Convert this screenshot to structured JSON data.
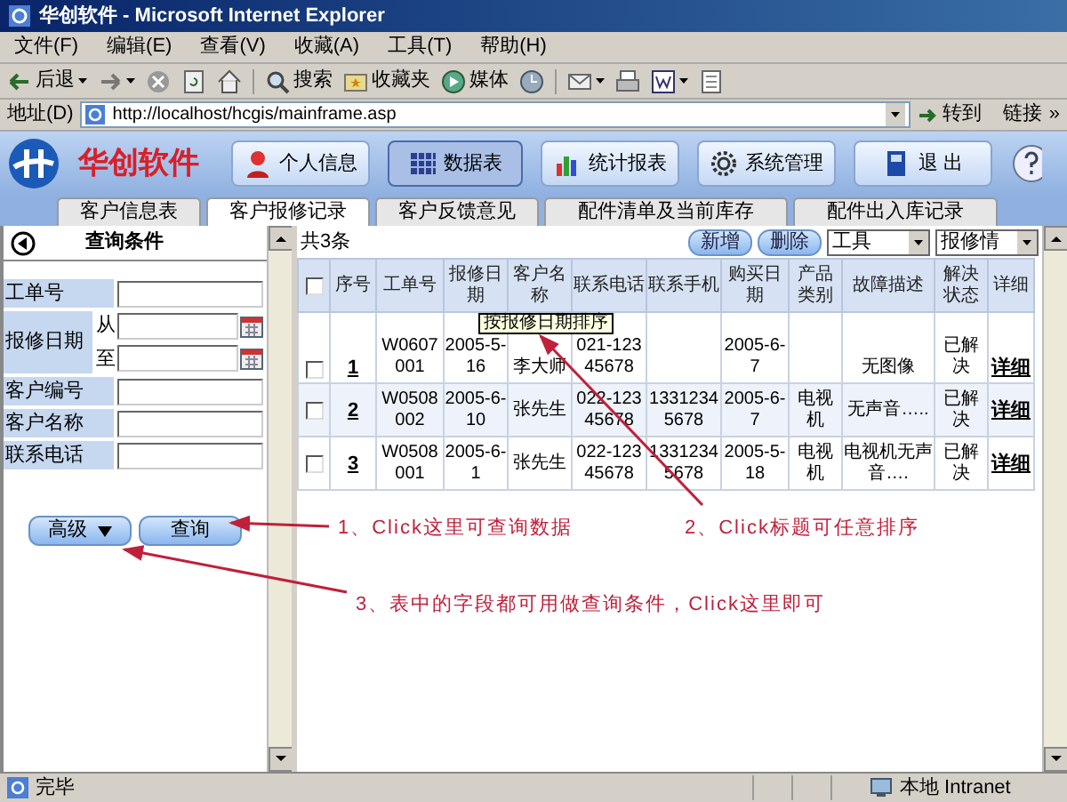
{
  "window": {
    "title": "华创软件 - Microsoft Internet Explorer"
  },
  "menu": [
    "文件(F)",
    "编辑(E)",
    "查看(V)",
    "收藏(A)",
    "工具(T)",
    "帮助(H)"
  ],
  "toolbar": [
    {
      "label": "后退",
      "dropdown": true
    },
    {
      "dropdown": true
    },
    {
      "dropdown": false
    },
    {
      "dropdown": false
    },
    {
      "dropdown": false
    },
    {
      "label": "搜索",
      "dropdown": false
    },
    {
      "label": "收藏夹",
      "dropdown": false
    },
    {
      "label": "媒体",
      "dropdown": false
    },
    {
      "dropdown": false
    },
    {
      "dropdown": true
    },
    {
      "dropdown": false
    },
    {
      "dropdown": true
    },
    {
      "dropdown": false
    }
  ],
  "address_bar": {
    "label": "地址(D)",
    "value": "http://localhost/hcgis/mainframe.asp",
    "go": "转到",
    "links": "链接",
    "more": "»"
  },
  "app": {
    "logo_text": "华创软件",
    "nav": [
      {
        "label": "个人信息",
        "selected": false
      },
      {
        "label": "数据表",
        "selected": true
      },
      {
        "label": "统计报表",
        "selected": false
      },
      {
        "label": "系统管理",
        "selected": false
      },
      {
        "label": "退 出",
        "selected": false
      }
    ],
    "tabs": [
      {
        "label": "客户信息表",
        "selected": false
      },
      {
        "label": "客户报修记录",
        "selected": true
      },
      {
        "label": "客户反馈意见",
        "selected": false
      },
      {
        "label": "配件清单及当前库存",
        "selected": false
      },
      {
        "label": "配件出入库记录",
        "selected": false
      }
    ]
  },
  "query_panel": {
    "title": "查询条件",
    "fields": [
      {
        "kind": "text",
        "label": "工单号"
      },
      {
        "kind": "date-range",
        "label": "报修日期",
        "parts": [
          {
            "label": "从"
          },
          {
            "label": "至"
          }
        ]
      },
      {
        "kind": "text",
        "label": "客户编号"
      },
      {
        "kind": "text",
        "label": "客户名称"
      },
      {
        "kind": "text",
        "label": "联系电话"
      }
    ],
    "buttons": [
      {
        "label": "高级",
        "dropdown": true
      },
      {
        "label": "查询",
        "dropdown": false
      }
    ]
  },
  "table": {
    "count": "共3条",
    "buttons": [
      "新增",
      "删除"
    ],
    "selects": [
      "工具",
      "报修情"
    ],
    "columns": [
      {
        "kind": "checkbox",
        "checked": false
      },
      {
        "kind": "link",
        "label": "序号"
      },
      {
        "kind": "text",
        "label": "工单号"
      },
      {
        "kind": "text",
        "label": "报修日期"
      },
      {
        "kind": "text",
        "label": "客户名称"
      },
      {
        "kind": "text",
        "label": "联系电话"
      },
      {
        "kind": "text",
        "label": "联系手机"
      },
      {
        "kind": "text",
        "label": "购买日期"
      },
      {
        "kind": "text",
        "label": "产品类别"
      },
      {
        "kind": "text",
        "label": "故障描述"
      },
      {
        "kind": "text",
        "label": "解决状态"
      },
      {
        "kind": "link",
        "label": "详细"
      }
    ],
    "rows": [
      {
        "checked": false,
        "cells": [
          null,
          "1",
          "W0607001",
          "2005-5-16",
          "李大师",
          "021-12345678",
          null,
          "2005-6-7",
          null,
          "无图像",
          "已解决",
          "详细"
        ]
      },
      {
        "checked": false,
        "cells": [
          null,
          "2",
          "W0508002",
          "2005-6-10",
          "张先生",
          "022-12345678",
          "13312345678",
          "2005-6-7",
          "电视机",
          "无声音…..",
          "已解决",
          "详细"
        ]
      },
      {
        "checked": false,
        "cells": [
          null,
          "3",
          "W0508001",
          "2005-6-1",
          "张先生",
          "022-12345678",
          "13312345678",
          "2005-5-18",
          "电视机",
          "电视机无声音….",
          "已解决",
          "详细"
        ]
      }
    ],
    "tooltip": "按报修日期排序"
  },
  "annotations": [
    "1、Click这里可查询数据",
    "2、Click标题可任意排序",
    "3、表中的字段都可用做查询条件，Click这里即可"
  ],
  "status_bar": {
    "text": "完毕",
    "zone": "本地 Intranet"
  }
}
